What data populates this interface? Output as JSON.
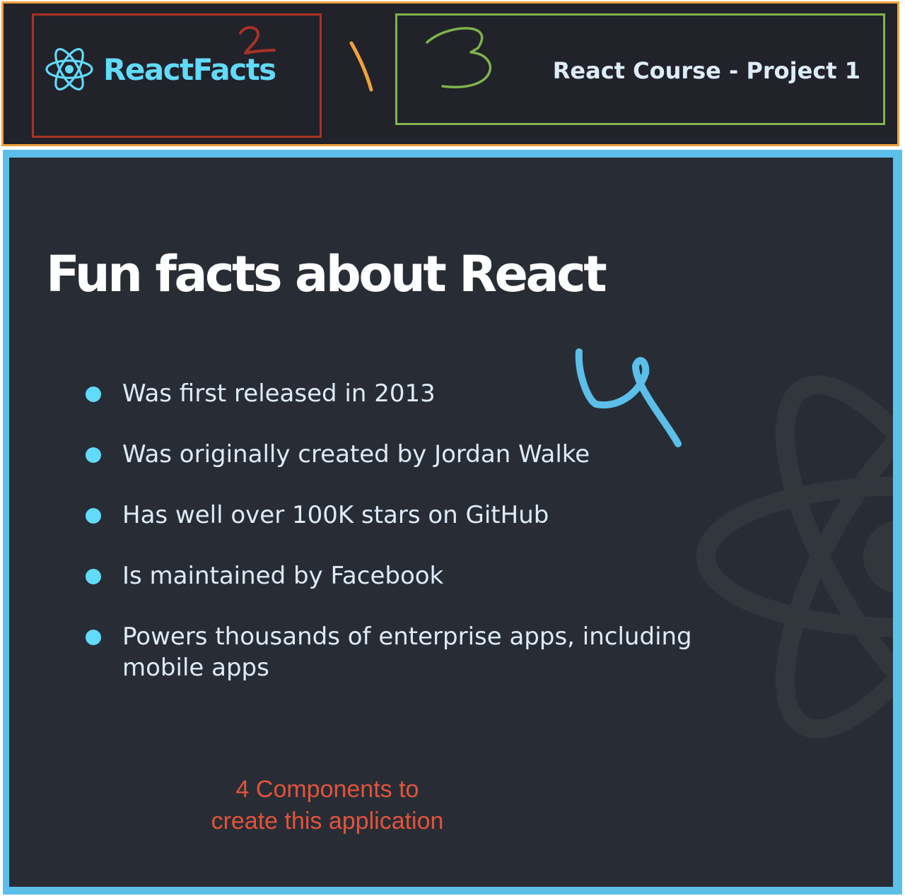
{
  "navbar": {
    "brand_name": "ReactFacts",
    "title": "React Course - Project 1"
  },
  "main": {
    "title": "Fun facts about React",
    "facts": [
      "Was first released in 2013",
      "Was originally created by Jordan Walke",
      "Has well over 100K stars on GitHub",
      "Is maintained by Facebook",
      "Powers thousands of enterprise apps, including mobile apps"
    ]
  },
  "annotations": {
    "marker_1": "1",
    "marker_2": "2",
    "marker_3": "3",
    "marker_4": "4",
    "note_line_1": "4 Components to",
    "note_line_2": "create this application"
  },
  "icons": {
    "brand_logo": "react-atom-icon",
    "background_logo": "react-atom-icon",
    "bullet": "filled-circle"
  },
  "colors": {
    "navbar_bg": "#21222a",
    "main_bg": "#282d35",
    "accent": "#61dafb",
    "text": "#deebf8",
    "title": "#ffffff",
    "annotation_text": "#e2533c",
    "box_navbar": "#f0a33a",
    "box_brand": "#a93224",
    "box_title": "#7fb34b",
    "box_main": "#5cbfe9"
  }
}
